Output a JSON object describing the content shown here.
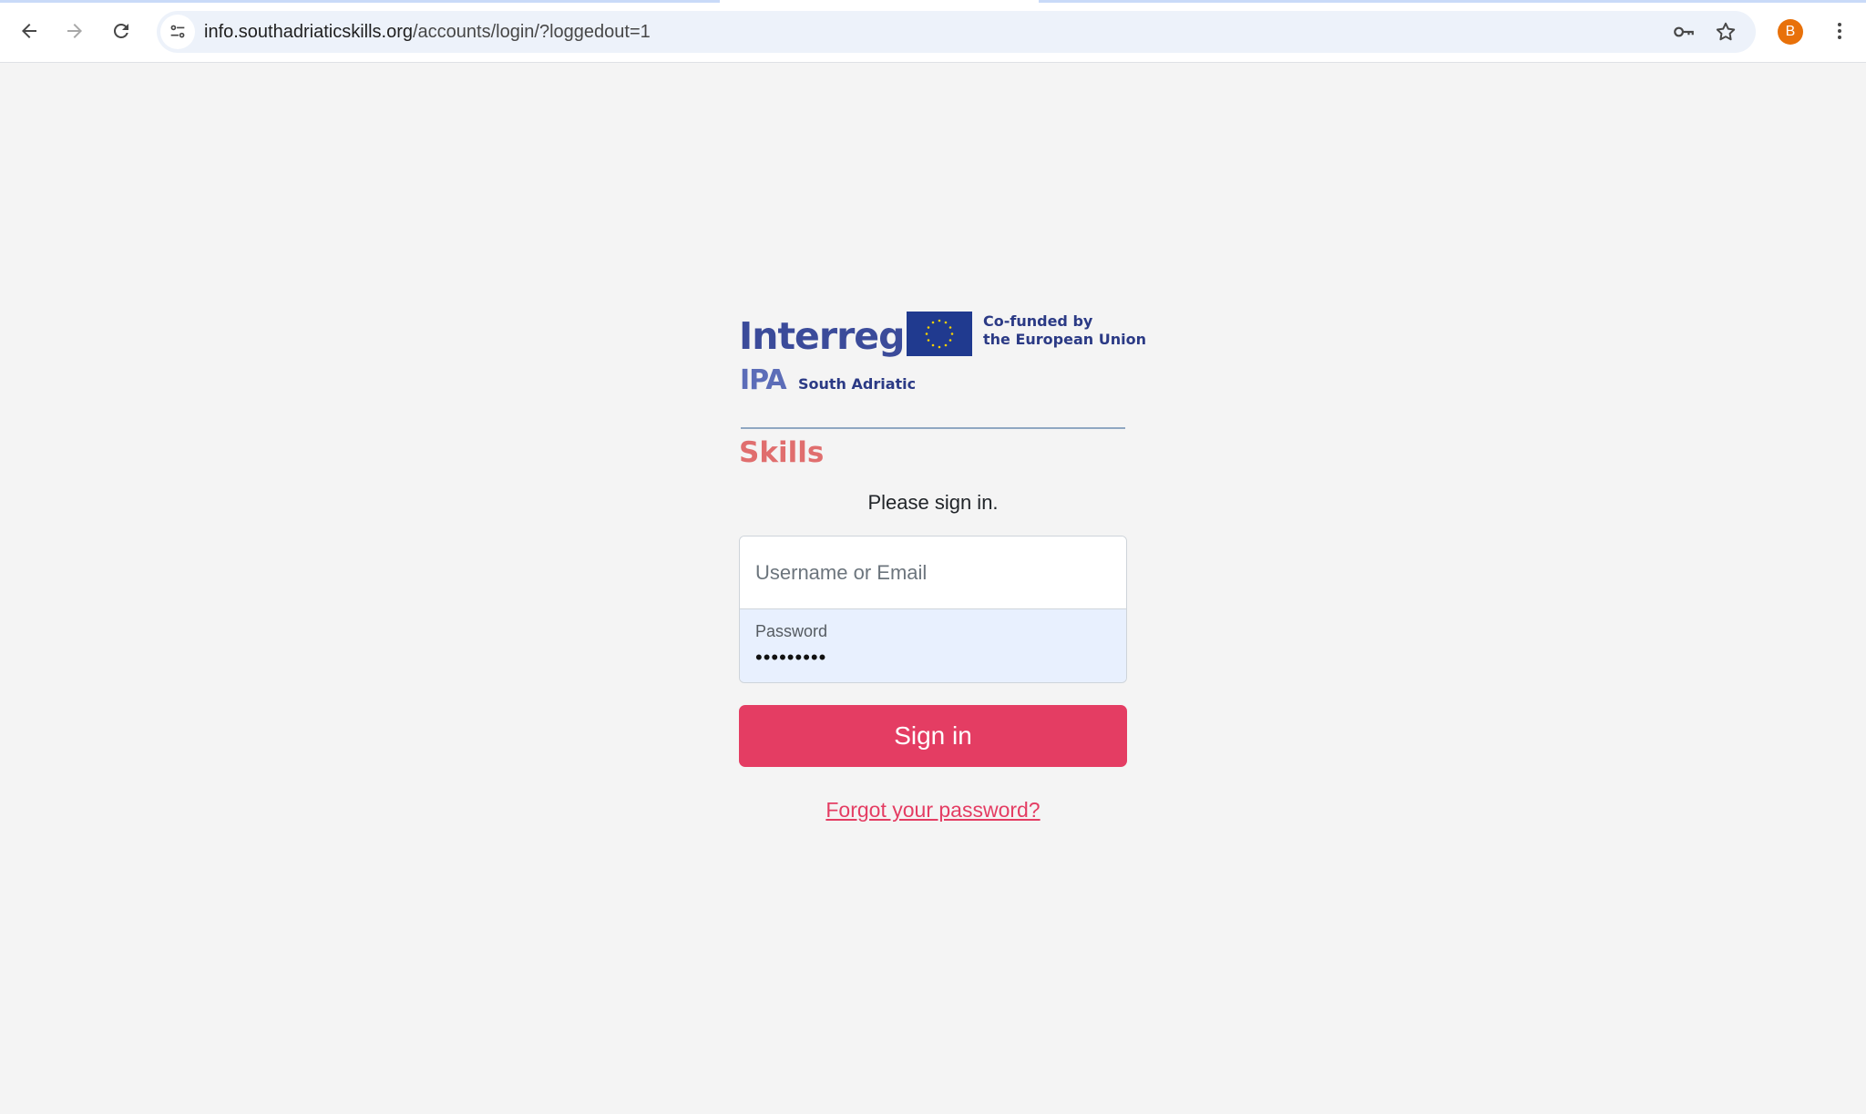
{
  "browser": {
    "url_host": "info.southadriaticskills.org",
    "url_path": "/accounts/login/?loggedout=1",
    "profile_initial": "B",
    "accent_color": "#e8710a"
  },
  "branding": {
    "program": "Interreg",
    "cofund_line1": "Co-funded by",
    "cofund_line2": "the European Union",
    "ipa": "IPA",
    "region": "South Adriatic",
    "product": "Skills"
  },
  "login": {
    "prompt": "Please sign in.",
    "username_placeholder": "Username or Email",
    "username_value": "",
    "password_label": "Password",
    "password_masked": "•••••••••",
    "submit_label": "Sign in",
    "forgot_label": "Forgot your password?",
    "button_color": "#e43d63"
  },
  "icons": {
    "back": "back-arrow-icon",
    "forward": "forward-arrow-icon",
    "reload": "reload-icon",
    "site_info": "site-settings-icon",
    "password_manager": "key-icon",
    "bookmark": "star-icon",
    "menu": "kebab-menu-icon"
  }
}
